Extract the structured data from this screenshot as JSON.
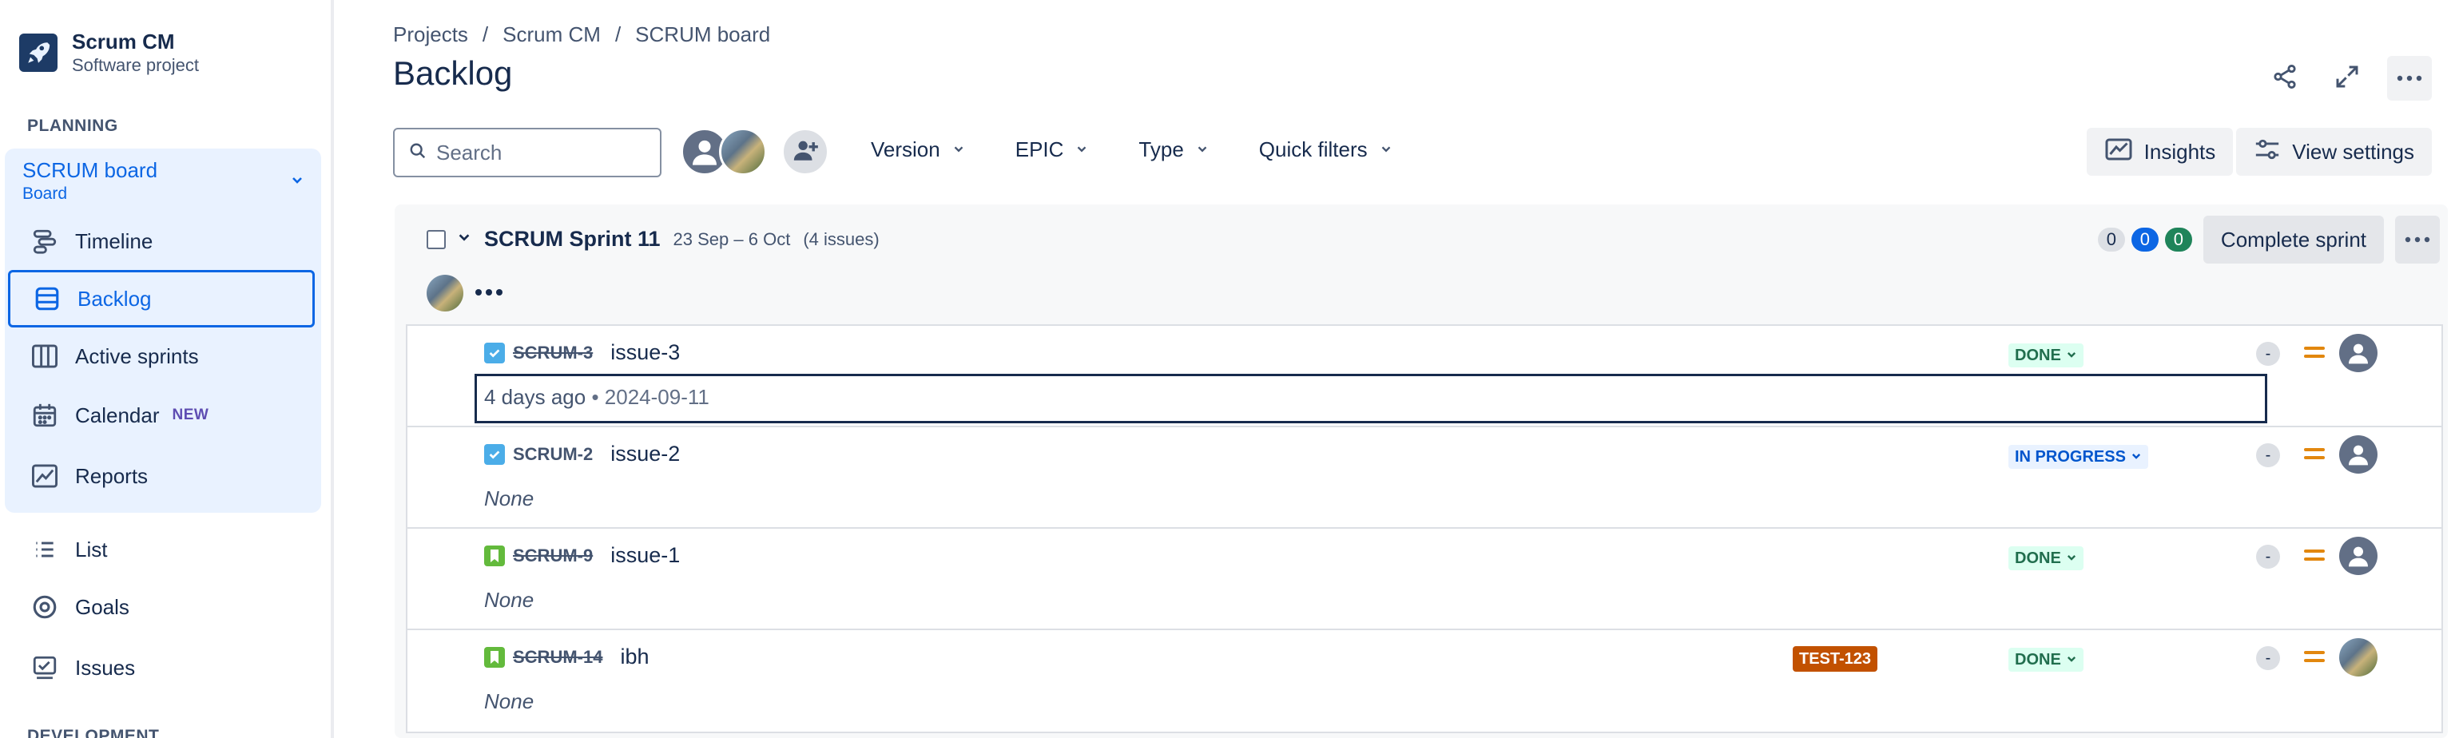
{
  "sidebar": {
    "project_name": "Scrum CM",
    "project_type": "Software project",
    "planning_label": "PLANNING",
    "board": {
      "name": "SCRUM board",
      "sub": "Board"
    },
    "items": [
      {
        "label": "Timeline",
        "icon": "timeline-icon"
      },
      {
        "label": "Backlog",
        "icon": "backlog-icon",
        "active": true
      },
      {
        "label": "Active sprints",
        "icon": "columns-icon"
      },
      {
        "label": "Calendar",
        "icon": "calendar-icon",
        "badge": "NEW"
      },
      {
        "label": "Reports",
        "icon": "chart-icon"
      },
      {
        "label": "List",
        "icon": "list-icon"
      },
      {
        "label": "Goals",
        "icon": "target-icon"
      },
      {
        "label": "Issues",
        "icon": "issues-icon"
      }
    ],
    "development_label": "DEVELOPMENT"
  },
  "breadcrumb": {
    "items": [
      "Projects",
      "Scrum CM",
      "SCRUM board"
    ],
    "separator": "/"
  },
  "page_title": "Backlog",
  "toolbar": {
    "search_placeholder": "Search",
    "filters": [
      "Version",
      "EPIC",
      "Type",
      "Quick filters"
    ],
    "insights_label": "Insights",
    "view_settings_label": "View settings"
  },
  "sprint": {
    "name": "SCRUM Sprint 11",
    "dates": "23 Sep – 6 Oct",
    "count": "(4 issues)",
    "todo": "0",
    "in_progress": "0",
    "done": "0",
    "complete_label": "Complete sprint"
  },
  "issues": [
    {
      "key": "SCRUM-3",
      "summary": "issue-3",
      "type": "task",
      "strike": true,
      "status": "DONE",
      "sub_primary": "4 days ago",
      "sub_secondary": "2024-09-11",
      "estimate": "-",
      "assignee": "default"
    },
    {
      "key": "SCRUM-2",
      "summary": "issue-2",
      "type": "task",
      "strike": false,
      "status": "IN PROGRESS",
      "sub_primary": "None",
      "estimate": "-",
      "assignee": "default"
    },
    {
      "key": "SCRUM-9",
      "summary": "issue-1",
      "type": "story",
      "strike": true,
      "status": "DONE",
      "sub_primary": "None",
      "estimate": "-",
      "assignee": "default"
    },
    {
      "key": "SCRUM-14",
      "summary": "ibh",
      "type": "story",
      "strike": true,
      "status": "DONE",
      "epic": "TEST-123",
      "sub_primary": "None",
      "estimate": "-",
      "assignee": "photo"
    }
  ],
  "colors": {
    "accent": "#0c66e4",
    "done_bg": "#dcfff1",
    "done_text": "#216e4e",
    "progress_bg": "#e9f2ff",
    "progress_text": "#0055cc",
    "epic": "#c25100",
    "priority": "#e2870e"
  }
}
